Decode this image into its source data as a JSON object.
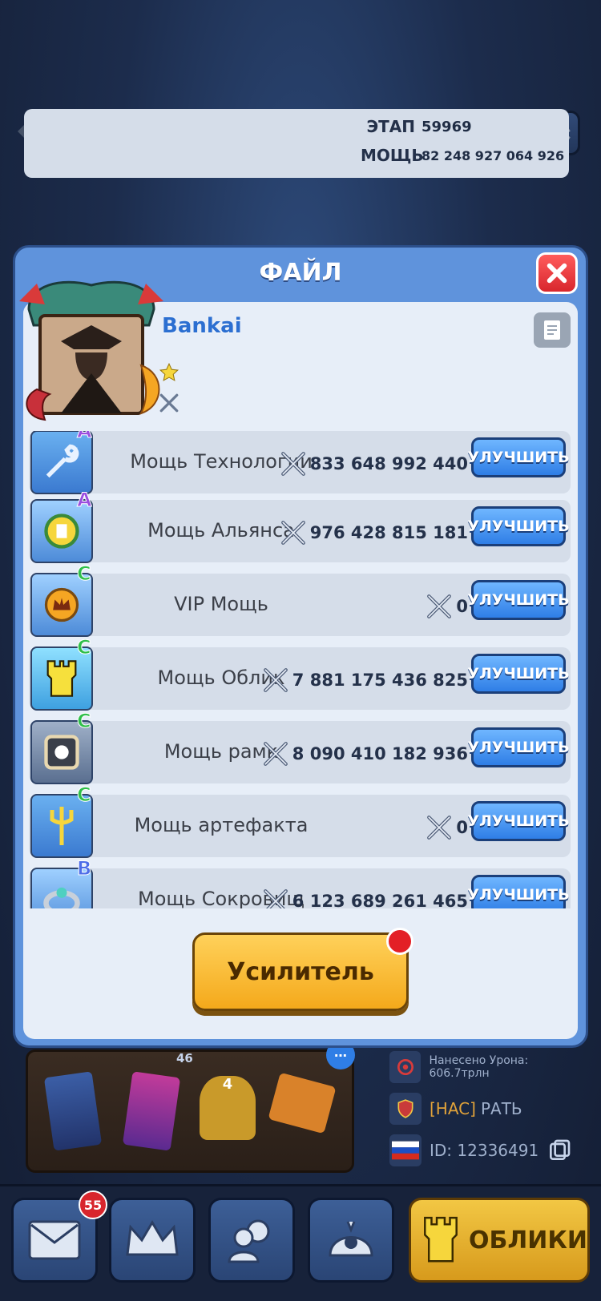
{
  "modal": {
    "title": "ФАЙЛ",
    "player_name": "Bankai",
    "stage_label": "ЭТАП",
    "stage_value": "59969",
    "power_label": "МОЩЬ",
    "power_value": "82 248 927 064 926"
  },
  "rows": [
    {
      "grade": "A",
      "label": "Мощь Технологии",
      "value": "833 648 992 440",
      "button": "УЛУЧШИТЬ",
      "icon": "wrench-icon"
    },
    {
      "grade": "A",
      "label": "Мощь Альянса",
      "value": "976 428 815 181",
      "button": "УЛУЧШИТЬ",
      "icon": "alliance-castle-icon"
    },
    {
      "grade": "C",
      "label": "VIP Мощь",
      "value": "0",
      "button": "УЛУЧШИТЬ",
      "icon": "vip-crown-icon"
    },
    {
      "grade": "C",
      "label": "Мощь Облик",
      "value": "7 881 175 436 825",
      "button": "УЛУЧШИТЬ",
      "icon": "tower-icon"
    },
    {
      "grade": "C",
      "label": "Мощь рамк",
      "value": "8 090 410 182 936",
      "button": "УЛУЧШИТЬ",
      "icon": "frame-icon"
    },
    {
      "grade": "C",
      "label": "Мощь артефакта",
      "value": "0",
      "button": "УЛУЧШИТЬ",
      "icon": "trident-icon"
    },
    {
      "grade": "B",
      "label": "Мощь Сокровищ",
      "value": "6 123 689 261 465",
      "button": "УЛУЧШИТЬ",
      "icon": "ring-icon"
    }
  ],
  "boost_button": "Усилитель",
  "background": {
    "damage_text": "Нанесено Урона: 606.7трлн",
    "guild_tag": "[HAC]",
    "guild_name": "РАТЬ",
    "id_text": "ID: 12336491",
    "card_badge": "46",
    "level_badge": "4"
  },
  "nav": {
    "mail_badge": "55",
    "skins_label": "ОБЛИКИ"
  },
  "colors": {
    "accent_blue": "#2f7ee6",
    "modal_blue": "#5f93dc",
    "gold": "#f4a91b",
    "alert_red": "#e31f26"
  }
}
